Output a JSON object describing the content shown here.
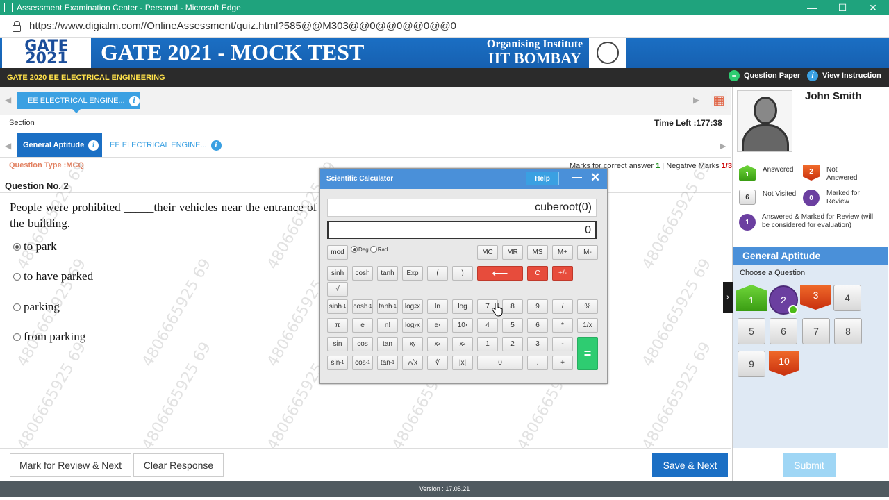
{
  "browser": {
    "title": "Assessment Examination Center - Personal - Microsoft Edge",
    "url": "https://www.digialm.com//OnlineAssessment/quiz.html?585@@M303@@0@@0@@0@@0",
    "min_label": "—",
    "max_label": "☐",
    "close_label": "✕"
  },
  "banner": {
    "logo_line1": "GATE",
    "logo_line2": "2021",
    "title": "GATE 2021 - MOCK TEST",
    "org_line1": "Organising Institute",
    "org_line2": "IIT BOMBAY"
  },
  "exam": {
    "name": "GATE 2020 EE ELECTRICAL ENGINEERING",
    "question_paper": "Question Paper",
    "view_instruction": "View Instruction"
  },
  "section": {
    "tab": "EE ELECTRICAL ENGINE...",
    "label": "Section",
    "time_left": "Time Left :177:38",
    "subtabs": [
      "General Aptitude",
      "EE ELECTRICAL ENGINE..."
    ]
  },
  "question": {
    "type": "Question Type :MCQ",
    "marks_prefix": "Marks for correct answer",
    "marks_correct": "1",
    "marks_sep": " | Negative Marks",
    "marks_negative": "1/3",
    "number": "Question No. 2",
    "text": "People were prohibited _____their vehicles near the entrance of the building.",
    "options": [
      "to park",
      "to have parked",
      "parking",
      "from parking"
    ],
    "selected_index": 0
  },
  "watermark": "4806665925 69",
  "calculator": {
    "title": "Scientific Calculator",
    "help": "Help",
    "minimize": "—",
    "close": "✕",
    "expression": "cuberoot(0)",
    "result": "0",
    "mode_deg": "Deg",
    "mode_rad": "Rad",
    "mode_selected": "Deg"
  },
  "candidate": {
    "name": "John Smith"
  },
  "legend": {
    "answered": "Answered",
    "answered_count": "1",
    "not_answered": "Not Answered",
    "not_answered_count": "2",
    "not_visited": "Not Visited",
    "not_visited_count": "6",
    "marked": "Marked for Review",
    "marked_count": "0",
    "answered_marked": "Answered & Marked for Review (will be considered for evaluation)",
    "answered_marked_count": "1"
  },
  "palette": {
    "heading": "General Aptitude",
    "choose": "Choose a Question",
    "questions": [
      {
        "n": "1",
        "status": "answered"
      },
      {
        "n": "2",
        "status": "answered-marked"
      },
      {
        "n": "3",
        "status": "not-answered"
      },
      {
        "n": "4",
        "status": "not-visited"
      },
      {
        "n": "5",
        "status": "not-visited"
      },
      {
        "n": "6",
        "status": "not-visited"
      },
      {
        "n": "7",
        "status": "not-visited"
      },
      {
        "n": "8",
        "status": "not-visited"
      },
      {
        "n": "9",
        "status": "not-visited"
      },
      {
        "n": "10",
        "status": "not-answered"
      }
    ]
  },
  "footer": {
    "mark_review": "Mark for Review & Next",
    "clear": "Clear Response",
    "save_next": "Save & Next",
    "submit": "Submit",
    "version": "Version : 17.05.21"
  },
  "colors": {
    "titlebar": "#1fa37d",
    "banner": "#1b6fc4",
    "answered": "#4cbb17",
    "not_answered": "#e0461a",
    "marked": "#6b3fa0",
    "accent": "#3aa0e2"
  }
}
